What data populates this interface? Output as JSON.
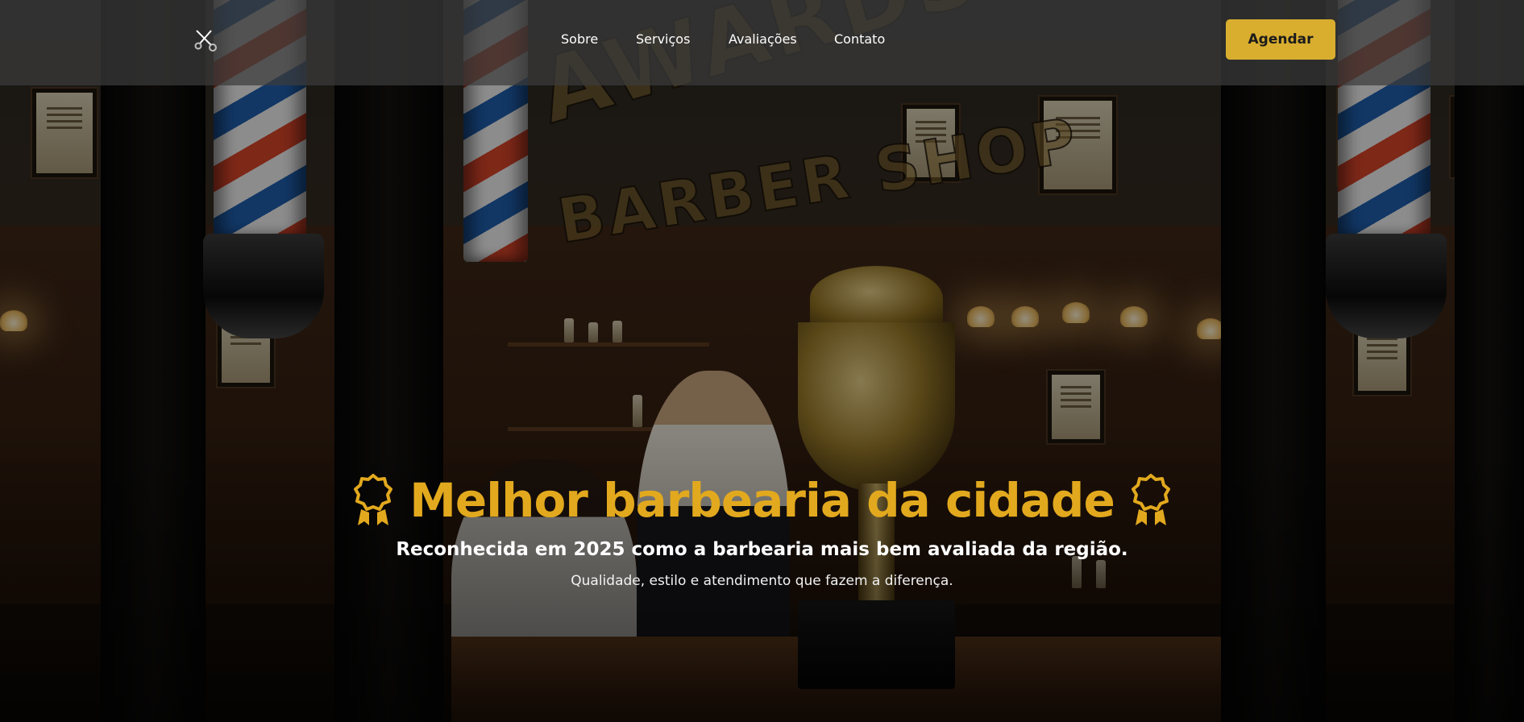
{
  "header": {
    "logo_icon": "scissors-icon",
    "nav": [
      {
        "label": "Sobre"
      },
      {
        "label": "Serviços"
      },
      {
        "label": "Avaliações"
      },
      {
        "label": "Contato"
      }
    ],
    "cta_label": "Agendar"
  },
  "hero": {
    "background_image": {
      "window_lettering": [
        "AWARDS",
        "BARBER SHOP"
      ]
    },
    "title": "Melhor barbearia da cidade",
    "title_icon": "award-medal-icon",
    "subtitle": "Reconhecida em 2025 como a barbearia mais bem avaliada da região.",
    "tagline": "Qualidade, estilo e atendimento que fazem a diferença."
  },
  "colors": {
    "accent": "#e2a91e",
    "button": "#d9ae2f",
    "header_bg": "#3c3c3c",
    "text": "#ffffff"
  }
}
